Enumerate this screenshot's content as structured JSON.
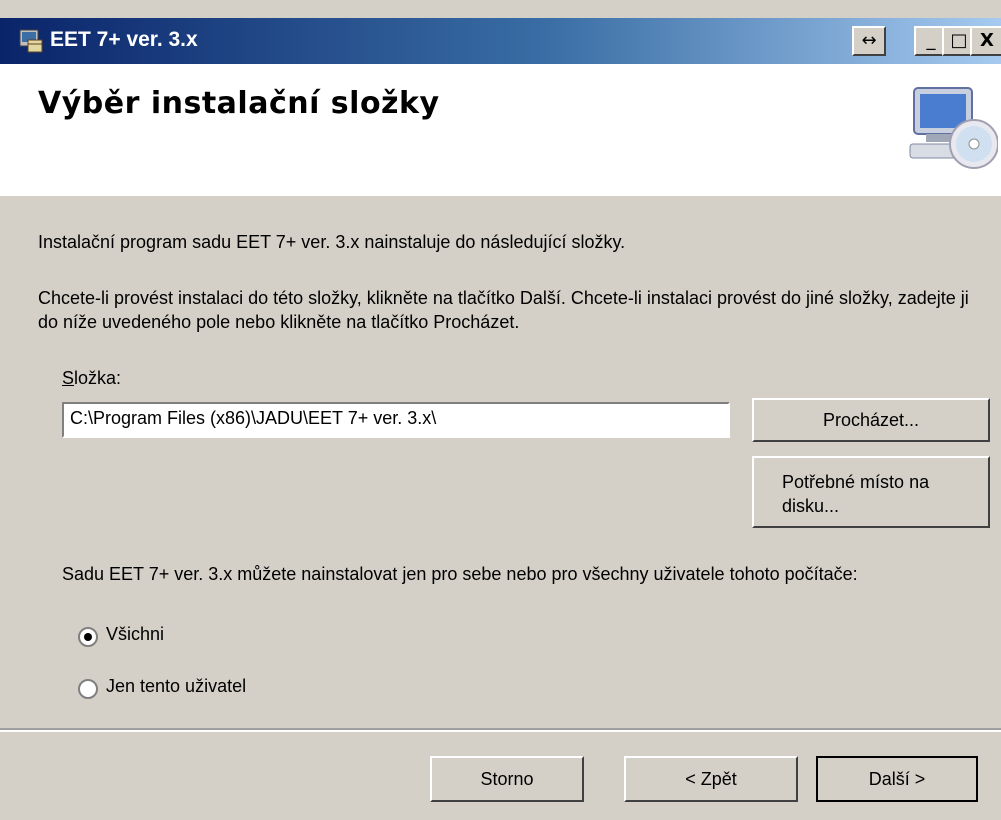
{
  "window": {
    "title": "EET 7+ ver. 3.x",
    "resize_glyph": "↔",
    "minimize_glyph": "_",
    "maximize_glyph": "□",
    "close_glyph": "X"
  },
  "header": {
    "title": "Výběr instalační složky"
  },
  "content": {
    "intro": "Instalační program sadu EET 7+ ver. 3.x nainstaluje do následující složky.",
    "instructions": "Chcete-li provést instalaci do této složky, klikněte na tlačítko Další. Chcete-li instalaci provést do jiné složky, zadejte ji do níže uvedeného pole nebo klikněte na tlačítko Procházet.",
    "folder_label_accel": "S",
    "folder_label_rest": "ložka:",
    "folder_path": "C:\\Program Files (x86)\\JADU\\EET 7+ ver. 3.x\\",
    "browse_button": "Procházet...",
    "disk_space_button": "Potřebné místo na disku...",
    "users_prompt": "Sadu EET 7+ ver. 3.x můžete nainstalovat jen pro sebe nebo pro všechny uživatele tohoto počítače:",
    "options": [
      {
        "label": "Všichni",
        "selected": true
      },
      {
        "label": "Jen tento uživatel",
        "selected": false
      }
    ]
  },
  "footer": {
    "cancel_button": "Storno",
    "back_button": "< Zpět",
    "next_button": "Další >"
  },
  "colors": {
    "titlebar_start": "#0a246a",
    "titlebar_end": "#a6caf0",
    "dialog_bg": "#d4d0c8"
  },
  "icons": {
    "app": "installer-icon",
    "header": "computer-cd-icon"
  }
}
